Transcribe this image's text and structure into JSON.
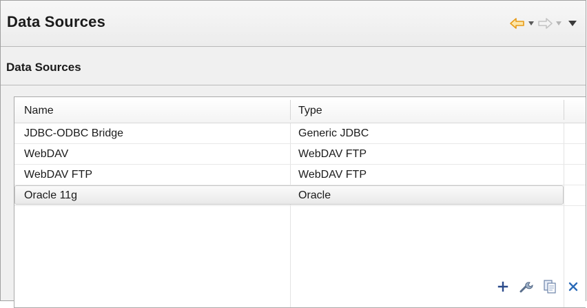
{
  "window": {
    "title": "Data Sources"
  },
  "nav": {
    "icons": [
      "back-arrow-icon",
      "chevron-down-icon",
      "forward-arrow-icon",
      "chevron-down-icon",
      "view-menu-icon"
    ]
  },
  "section": {
    "title": "Data Sources"
  },
  "table": {
    "columns": [
      "Name",
      "Type"
    ],
    "rows": [
      {
        "name": "JDBC-ODBC Bridge",
        "type": "Generic JDBC"
      },
      {
        "name": "WebDAV",
        "type": "WebDAV FTP"
      },
      {
        "name": "WebDAV FTP",
        "type": "WebDAV FTP"
      },
      {
        "name": "Oracle 11g",
        "type": "Oracle"
      }
    ],
    "selected_row": "Oracle 11g"
  },
  "actions": {
    "icons": [
      "add-icon",
      "edit-icon",
      "copy-icon",
      "delete-icon"
    ]
  },
  "colors": {
    "back_arrow": "#f0a020",
    "disabled_arrow": "#c8c8c8",
    "add": "#2a4a8a",
    "delete": "#2a6ab8"
  }
}
